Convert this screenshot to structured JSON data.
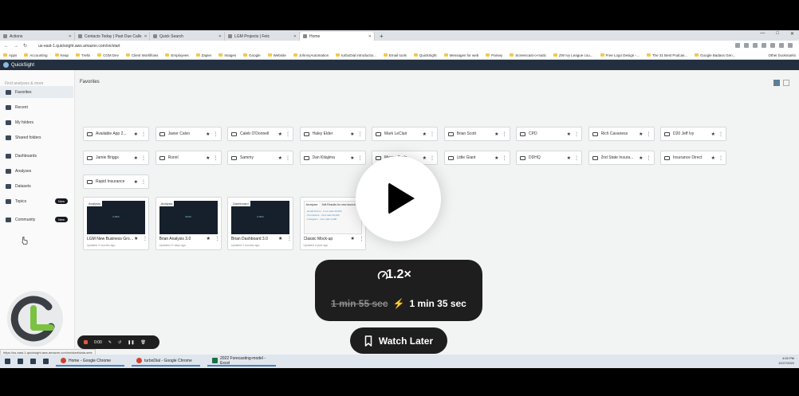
{
  "browser": {
    "tabs": [
      {
        "label": "Actions",
        "active": false
      },
      {
        "label": "Contacts Today | Past Due Calls",
        "active": false
      },
      {
        "label": "Quick Search",
        "active": false
      },
      {
        "label": "LGM Projects | Fetc",
        "active": false
      },
      {
        "label": "Home",
        "active": true
      }
    ],
    "new_tab": "+",
    "window_controls": [
      "—",
      "□",
      "✕"
    ],
    "url": "us-east-1.quicksight.aws.amazon.com/sn/start",
    "nav": [
      "←",
      "→",
      "↻"
    ],
    "bookmarks": [
      "Apps",
      "Accounting",
      "Keap",
      "Trello",
      "CGM Dev",
      "Client Workflows",
      "Employees",
      "Zapier",
      "Images",
      "Google",
      "Website",
      "JohnnyAutomation",
      "turboDial introductio...",
      "Email tools",
      "QuickSight",
      "Messages for web",
      "Parsey",
      "Screencast-o-matic",
      "ZW Ivy League cou...",
      "Free Logo Design -...",
      "The 31 Best Podcas...",
      "Google Badass Gen..."
    ],
    "other_bookmarks": "Other bookmarks"
  },
  "app": {
    "title": "QuickSight"
  },
  "sidebar": {
    "search_placeholder": "Find analyses & more",
    "items": [
      {
        "label": "Favorites",
        "active": true,
        "badge": ""
      },
      {
        "label": "Recent",
        "active": false,
        "badge": ""
      },
      {
        "label": "My folders",
        "active": false,
        "badge": ""
      },
      {
        "label": "Shared folders",
        "active": false,
        "badge": ""
      },
      {
        "label": "Dashboards",
        "active": false,
        "badge": ""
      },
      {
        "label": "Analyses",
        "active": false,
        "badge": ""
      },
      {
        "label": "Datasets",
        "active": false,
        "badge": ""
      },
      {
        "label": "Topics",
        "active": false,
        "badge": "New"
      },
      {
        "label": "Community",
        "active": false,
        "badge": "New"
      }
    ]
  },
  "main": {
    "title": "Favorites",
    "folders": [
      "Available App 2...",
      "Javier Calvo",
      "Caleb O'Donnell",
      "Haley Elder",
      "Mark LeClair",
      "Brian Scott",
      "CPD",
      "Rich Cavaness",
      "D20 Jeff Ivy",
      "Jamie Briggs",
      "Ronnl",
      "Sammy",
      "Dan Kitajima",
      "Megan Teale",
      "Little Giant",
      "DDHQ",
      "2nd State Insura...",
      "Insurance Direct",
      "Rapid Insurance"
    ],
    "cards": [
      {
        "tag": "Analysis",
        "name": "LGM New Business Growth ...",
        "updated": "Updated 3 months ago",
        "thumb_text": "0.00%"
      },
      {
        "tag": "Analysis",
        "name": "Brian Analysis 3.0",
        "updated": "Updated 12 days ago",
        "thumb_text": "30.00"
      },
      {
        "tag": "Dashboard",
        "name": "Brian Dashboard 3.0",
        "updated": "Updated 2 months ago",
        "thumb_text": "0.00%"
      },
      {
        "tag": "Analysis",
        "name": "Classic Mock-up",
        "updated": "Updated a year ago",
        "thumb_text": "Sell Results for new launch of",
        "mock_lines": [
          "- Email Promo - 1,xxx sale 20,000",
          "- Promotions - 3xxx sale 30,000",
          "- Instagram - 1xxx sale 4,000"
        ]
      }
    ]
  },
  "status_link": "https://us-east-1.quicksight.aws.amazon.com/sn/start/data-sets",
  "taskbar": {
    "apps": [
      "Home - Google Chrome",
      "turboDial - Google Chrome",
      "2022 Forecasting-model - Excel"
    ],
    "time": "4:00 PM",
    "date": "12/27/2022"
  },
  "recorder": {
    "elapsed": "0:00"
  },
  "overlay": {
    "speed": "1.2×",
    "original_time": "1 min 55 sec",
    "new_time": "1 min 35 sec",
    "watch_later": "Watch Later",
    "accent": "#f59a2c"
  }
}
